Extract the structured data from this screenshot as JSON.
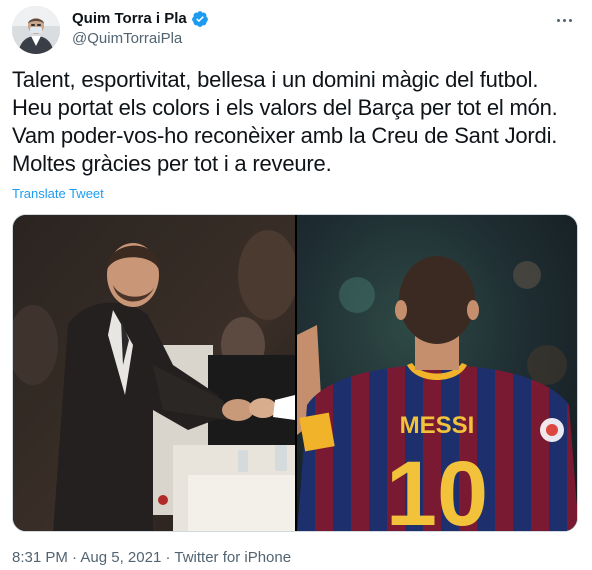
{
  "user": {
    "display_name": "Quim Torra i Pla",
    "handle": "@QuimTorraiPla",
    "verified": true,
    "avatar_icon": "profile-photo"
  },
  "more_icon": "more-horizontal-icon",
  "tweet": {
    "text": "Talent, esportivitat, bellesa i un domini màgic del futbol. Heu portat els colors i els valors del Barça per tot el món. Vam poder-vos-ho reconèixer amb la Creu de Sant Jordi. Moltes gràcies per tot i a reveure.",
    "translate_label": "Translate Tweet"
  },
  "media": {
    "jersey_name": "MESSI",
    "jersey_number": "10"
  },
  "meta": {
    "time": "8:31 PM",
    "separator": " · ",
    "date": "Aug 5, 2021",
    "source": "Twitter for iPhone"
  },
  "colors": {
    "link_blue": "#1d9bf0",
    "verified_blue": "#1d9bf0",
    "secondary_text": "#536471"
  }
}
